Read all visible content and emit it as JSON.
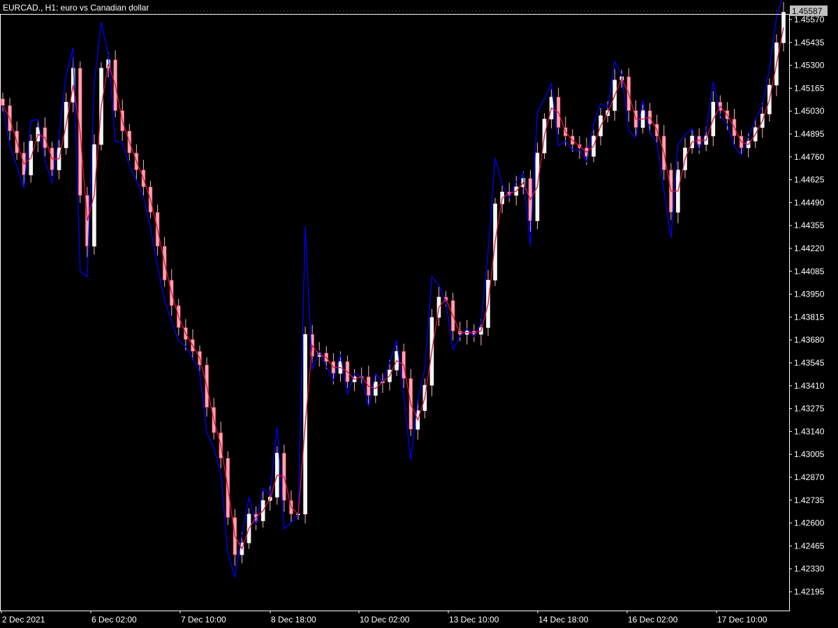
{
  "header": {
    "symbol": "EURCAD.",
    "timeframe": "H1",
    "title": "EURCAD., H1:  euro vs Canadian dollar"
  },
  "colors": {
    "background": "#000000",
    "frame": "#ffffff",
    "bull_candle": "#ffffff",
    "bear_candle": "#dc143c",
    "ma_fast": "#dc143c",
    "ma_slow": "#0000ff",
    "price_box_bg": "#c0c0c0",
    "price_box_text": "#000000"
  },
  "chart_data": {
    "type": "candlestick",
    "title": "EURCAD., H1:  euro vs Canadian dollar",
    "xlabel": "",
    "ylabel": "",
    "ylim": [
      1.421,
      1.4565
    ],
    "y_ticks": [
      "1.45570",
      "1.45435",
      "1.45300",
      "1.45165",
      "1.45030",
      "1.44895",
      "1.44760",
      "1.44625",
      "1.44490",
      "1.44355",
      "1.44220",
      "1.44085",
      "1.43950",
      "1.43815",
      "1.43680",
      "1.43545",
      "1.43410",
      "1.43275",
      "1.43140",
      "1.43005",
      "1.42870",
      "1.42735",
      "1.42600",
      "1.42465",
      "1.42330",
      "1.42195"
    ],
    "x_ticks": [
      "2 Dec 2021",
      "6 Dec 02:00",
      "7 Dec 10:00",
      "8 Dec 18:00",
      "10 Dec 02:00",
      "13 Dec 10:00",
      "14 Dec 18:00",
      "16 Dec 02:00",
      "17 Dec 10:00"
    ],
    "current_price": "1.45587",
    "grid": false,
    "series": [
      {
        "kind": "close",
        "values": [
          1.4503,
          1.4488,
          1.4475,
          1.4462,
          1.4482,
          1.449,
          1.4478,
          1.4465,
          1.4478,
          1.4505,
          1.4525,
          1.445,
          1.442,
          1.448,
          1.4525,
          1.453,
          1.45,
          1.4488,
          1.4475,
          1.4465,
          1.4455,
          1.444,
          1.442,
          1.44,
          1.4385,
          1.4372,
          1.4365,
          1.4358,
          1.435,
          1.4325,
          1.431,
          1.4295,
          1.426,
          1.4238,
          1.4245,
          1.4262,
          1.4258,
          1.427,
          1.4272,
          1.4298,
          1.427,
          1.4262,
          1.4262,
          1.4368,
          1.4355,
          1.4357,
          1.4352,
          1.4345,
          1.4352,
          1.434,
          1.4343,
          1.4343,
          1.4332,
          1.434,
          1.434,
          1.4347,
          1.4358,
          1.4342,
          1.4312,
          1.4323,
          1.4338,
          1.4378,
          1.439,
          1.4388,
          1.437,
          1.4368,
          1.437,
          1.4368,
          1.4372,
          1.44,
          1.4445,
          1.4452,
          1.445,
          1.4455,
          1.446,
          1.4435,
          1.4475,
          1.4495,
          1.4508,
          1.449,
          1.4485,
          1.448,
          1.4478,
          1.4473,
          1.4485,
          1.4497,
          1.45,
          1.4518,
          1.452,
          1.45,
          1.449,
          1.45,
          1.4492,
          1.4485,
          1.4465,
          1.444,
          1.4465,
          1.4478,
          1.4485,
          1.448,
          1.4485,
          1.4505,
          1.45,
          1.4495,
          1.4485,
          1.4478,
          1.4482,
          1.449,
          1.4498,
          1.4515,
          1.454,
          1.4558
        ]
      }
    ]
  }
}
